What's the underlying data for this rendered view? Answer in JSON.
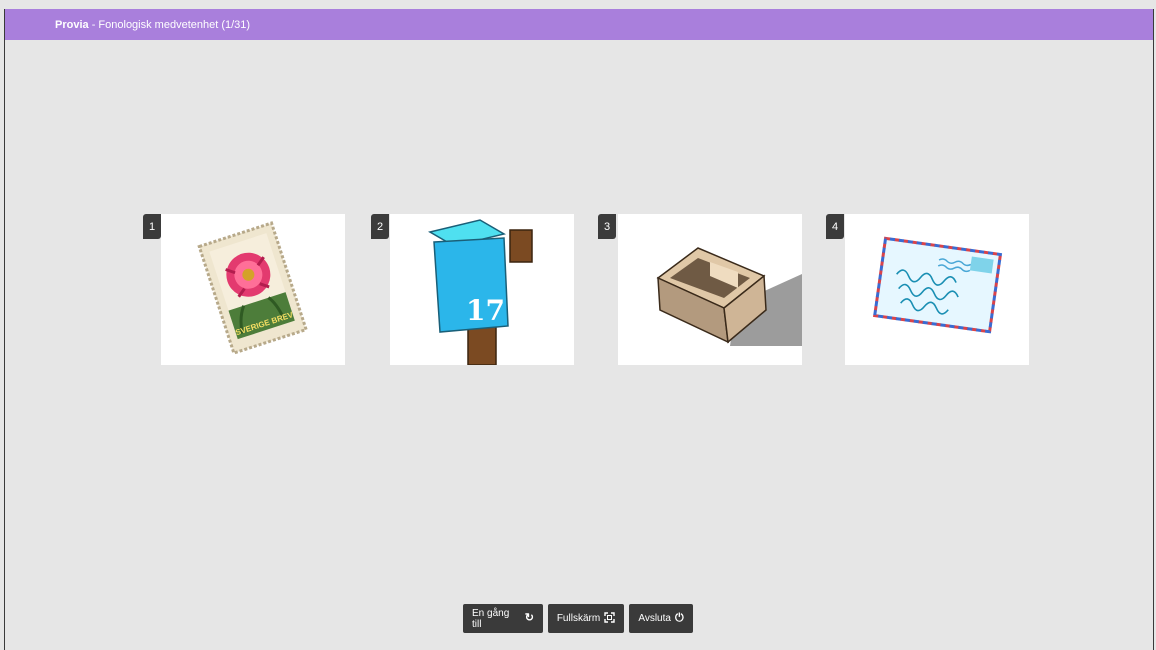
{
  "header": {
    "brand": "Provia",
    "separator": " - ",
    "title": "Fonologisk medvetenhet (1/31)"
  },
  "cards": [
    {
      "number": "1",
      "subject": "stamp",
      "stamp_text": "SVERIGE BREV"
    },
    {
      "number": "2",
      "subject": "mailbox",
      "mailbox_number": "17"
    },
    {
      "number": "3",
      "subject": "box"
    },
    {
      "number": "4",
      "subject": "envelope"
    }
  ],
  "buttons": {
    "again": {
      "label": "En gång till",
      "icon": "reload-icon"
    },
    "fullscreen": {
      "label": "Fullskärm",
      "icon": "fullscreen-icon"
    },
    "quit": {
      "label": "Avsluta",
      "icon": "power-icon"
    }
  },
  "colors": {
    "header": "#a97fdc",
    "background": "#e6e6e6",
    "button": "#3a3a3a"
  }
}
